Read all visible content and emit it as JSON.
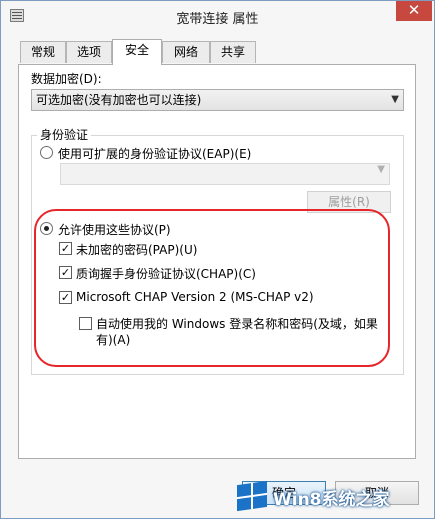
{
  "window": {
    "title": "宽带连接 属性",
    "close_glyph": "✕"
  },
  "tabs": [
    {
      "label": "常规",
      "active": false
    },
    {
      "label": "选项",
      "active": false
    },
    {
      "label": "安全",
      "active": true
    },
    {
      "label": "网络",
      "active": false
    },
    {
      "label": "共享",
      "active": false
    }
  ],
  "security": {
    "encryption_label": "数据加密(D):",
    "encryption_value": "可选加密(没有加密也可以连接)",
    "auth_group_title": "身份验证",
    "eap_option": {
      "label": "使用可扩展的身份验证协议(EAP)(E)",
      "selected": false
    },
    "eap_select_value": "",
    "eap_properties_button": "属性(R)",
    "allow_protocols": {
      "label": "允许使用这些协议(P)",
      "selected": true
    },
    "protocols": [
      {
        "label": "未加密的密码(PAP)(U)",
        "checked": true
      },
      {
        "label": "质询握手身份验证协议(CHAP)(C)",
        "checked": true
      },
      {
        "label": "Microsoft CHAP Version 2 (MS-CHAP v2)",
        "checked": true
      }
    ],
    "auto_logon": {
      "line1": "自动使用我的 Windows 登录名称和密码(及域，如果",
      "line2": "有)(A)",
      "checked": false
    }
  },
  "footer": {
    "ok_button": "确定",
    "cancel_button": "取消"
  },
  "watermark": {
    "text": "Win8系统之家"
  },
  "colors": {
    "highlight_outline": "#e5262a",
    "close_button": "#c7483e",
    "watermark_logo": "#1a73c7"
  },
  "icons": {
    "close": "close-icon",
    "system_menu": "system-menu-icon",
    "dropdown": "chevron-down-icon",
    "check": "checkmark-icon",
    "watermark_logo": "windows-logo-icon"
  }
}
